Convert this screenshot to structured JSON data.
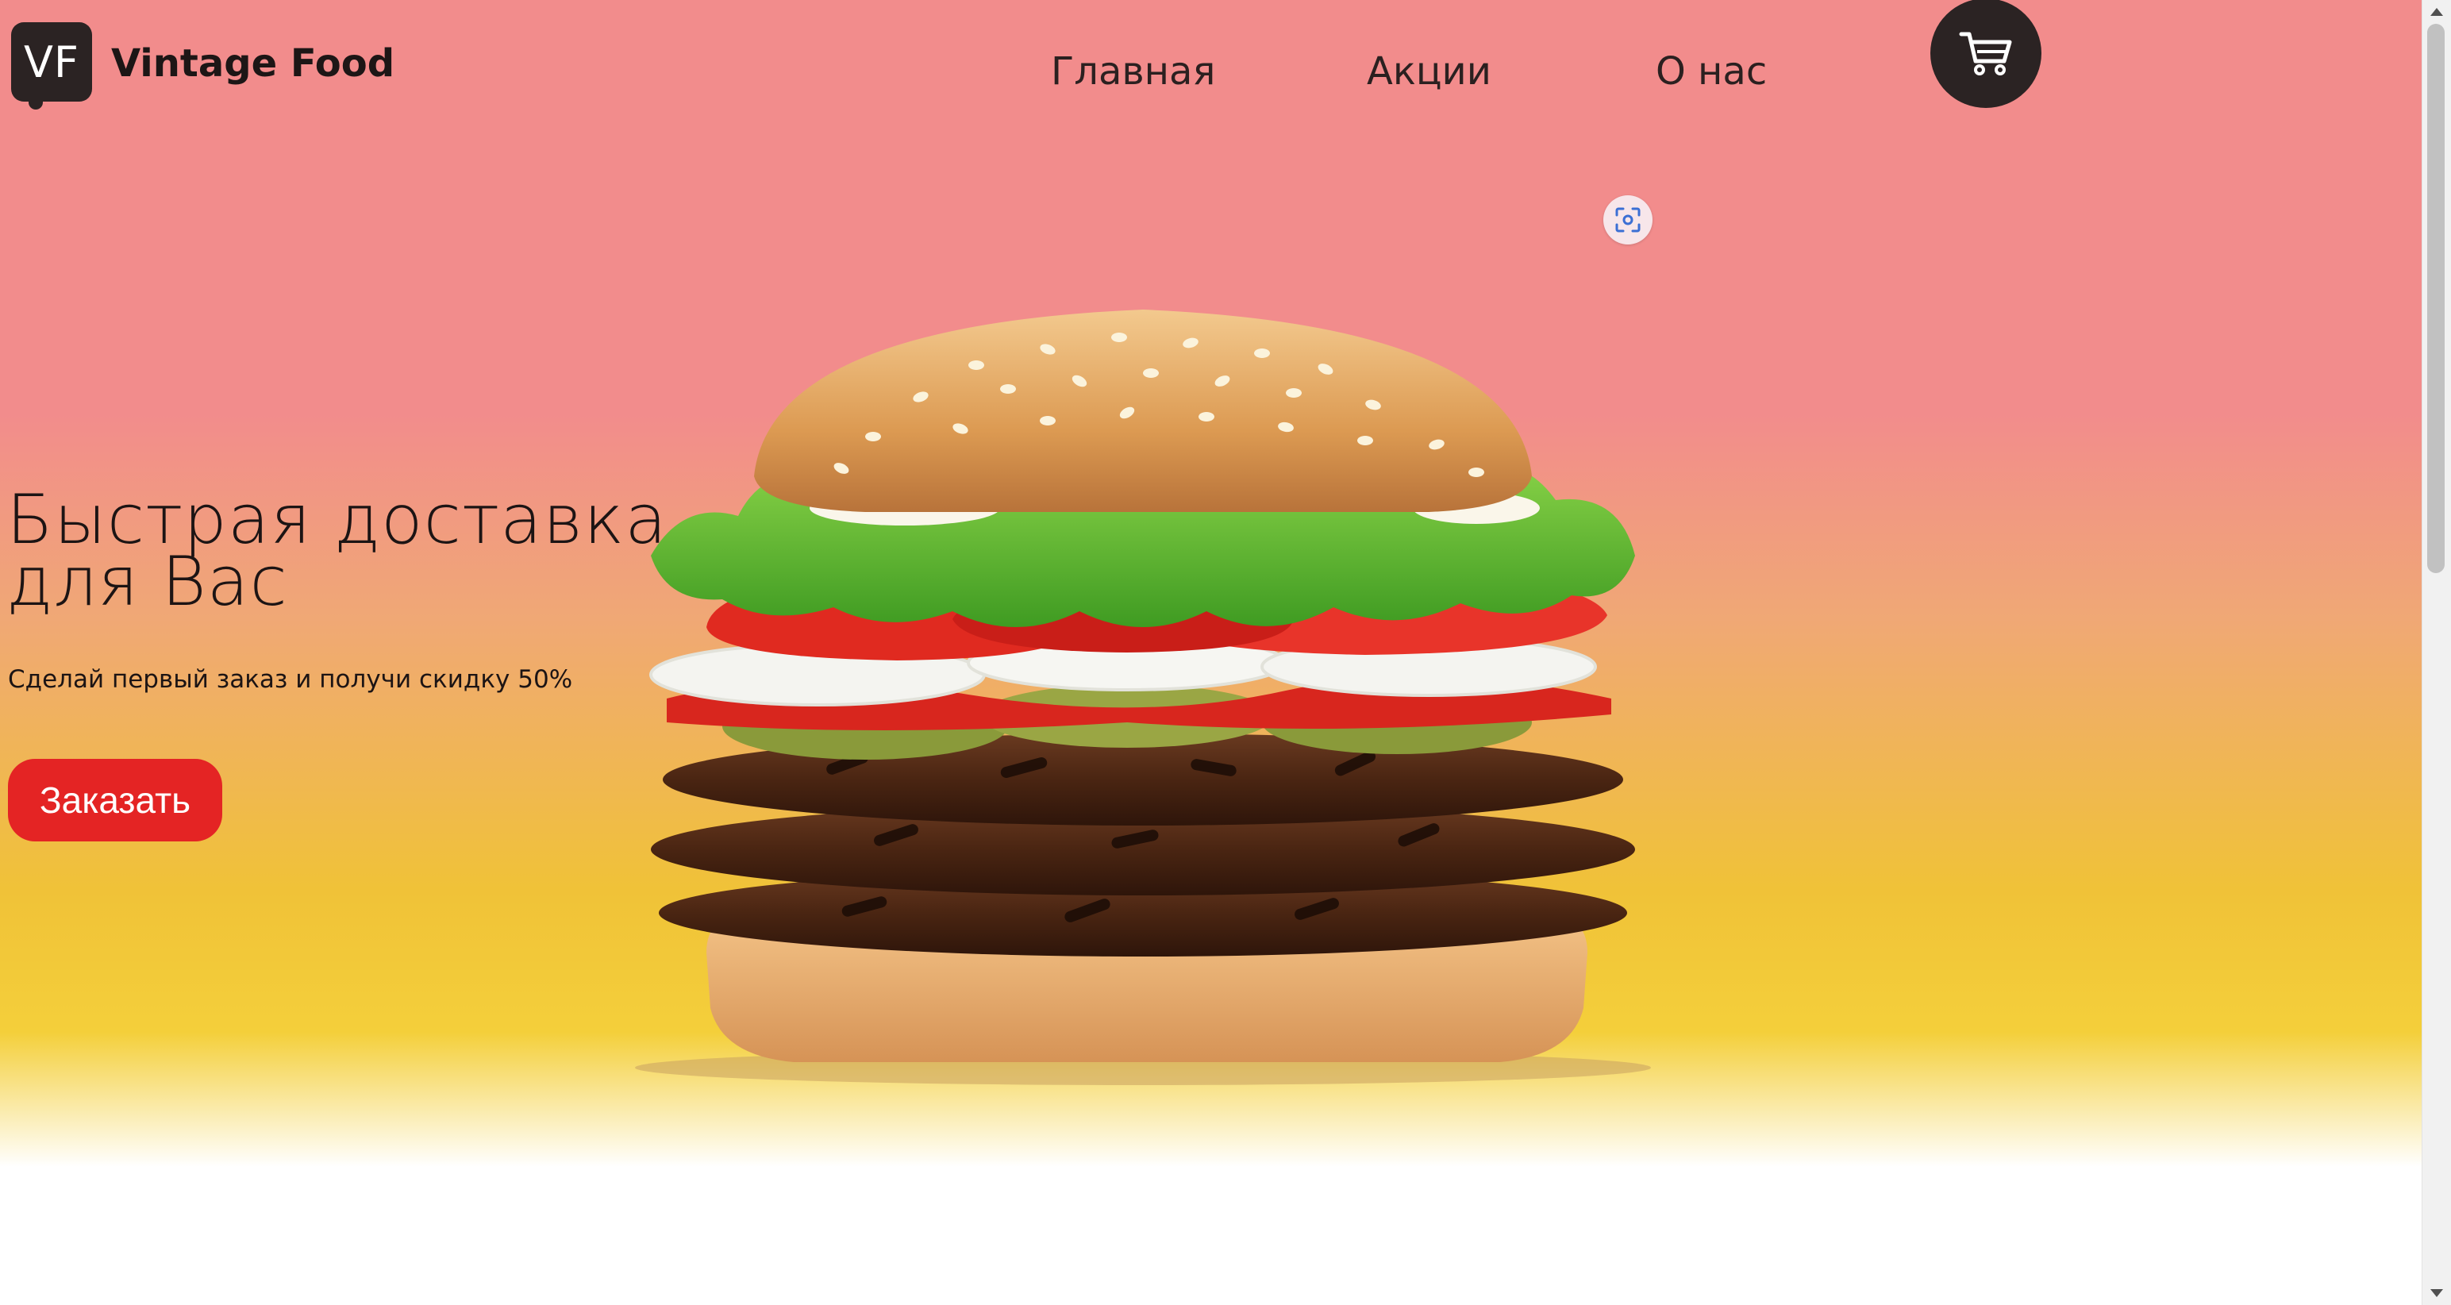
{
  "brand": {
    "logo_mark": "VF",
    "name": "Vintage Food"
  },
  "nav": {
    "items": [
      {
        "label": "Главная"
      },
      {
        "label": "Акции"
      },
      {
        "label": "О нас"
      }
    ],
    "cart_icon": "shopping-cart-icon"
  },
  "overlay": {
    "lens_icon": "screen-capture-icon"
  },
  "hero": {
    "title": "Быстрая доставка для Вас",
    "subtitle": "Сделай первый заказ и получи скидку 50%",
    "cta_label": "Заказать",
    "image_icon": "burger-image"
  },
  "colors": {
    "bg_top": "#f28c8c",
    "bg_mid": "#f0c238",
    "bg_bottom": "#ffffff",
    "dark": "#2b2323",
    "cta": "#e42424"
  }
}
